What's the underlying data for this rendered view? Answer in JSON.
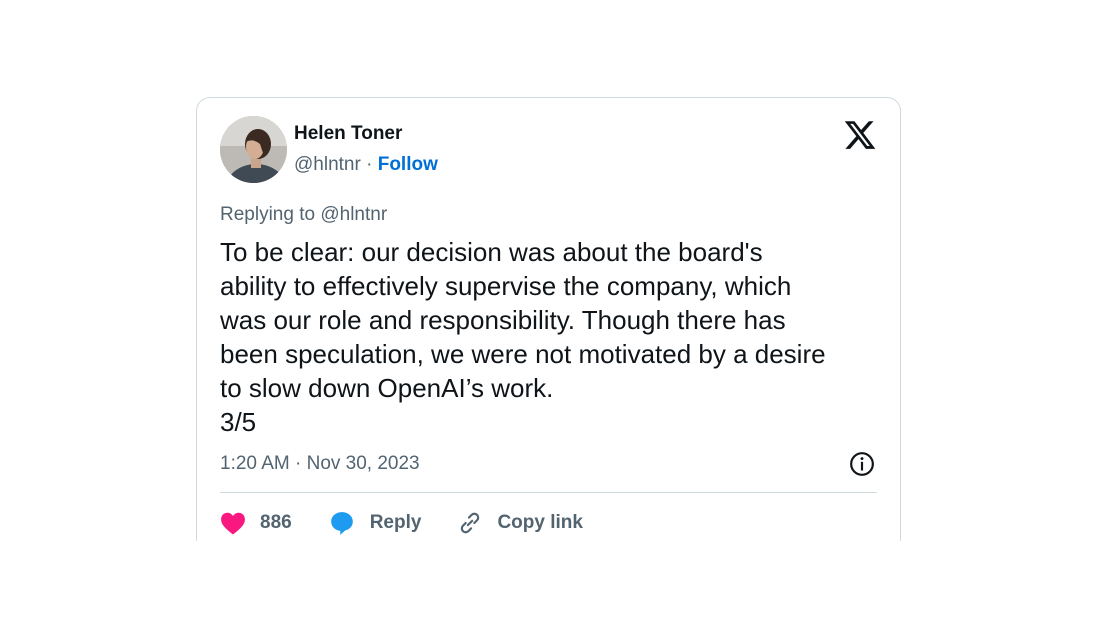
{
  "author": {
    "name": "Helen Toner",
    "handle": "@hlntnr",
    "separator": "·",
    "follow_label": "Follow",
    "avatar": "profile-photo"
  },
  "platform_icon": "x-logo-icon",
  "tweet": {
    "replying_prefix": "Replying to ",
    "replying_to": "@hlntnr",
    "text": "To be clear: our decision was about the board's\nability to effectively supervise the company, which\nwas our role and responsibility. Though there has\nbeen speculation, we were not motivated by a desire\nto slow down OpenAI’s work.\n3/5",
    "timestamp": "1:20 AM · Nov 30, 2023"
  },
  "actions": {
    "like_count": "886",
    "reply_label": "Reply",
    "copy_link_label": "Copy link"
  },
  "colors": {
    "like": "#f91880",
    "reply": "#1d9bf0",
    "link": "#006fd6",
    "muted": "#536471"
  }
}
